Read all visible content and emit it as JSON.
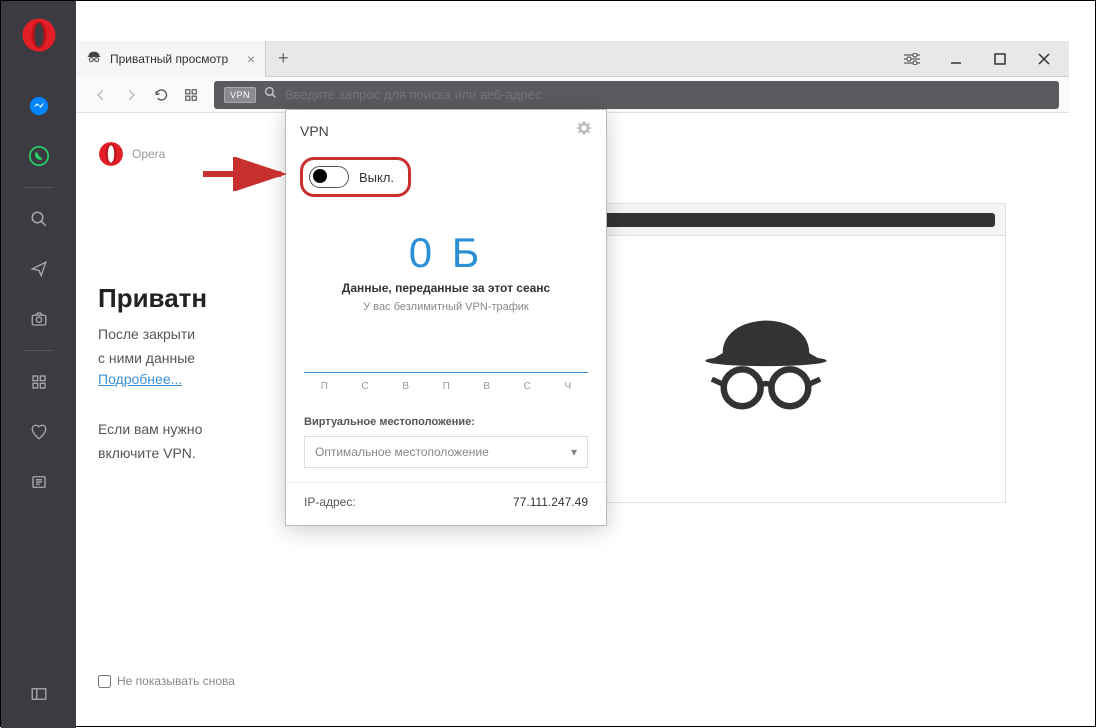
{
  "tab": {
    "title": "Приватный просмотр"
  },
  "address": {
    "placeholder": "Введите запрос для поиска или веб-адрес",
    "vpn_badge": "VPN"
  },
  "page": {
    "logo_text": "Opera",
    "heading": "Приватн",
    "line1": "После закрыти",
    "line2": "с ними данные",
    "learn_more": "Подробнее...",
    "line3": "Если вам нужно",
    "line4": "включите VPN.",
    "dont_show": "Не показывать снова"
  },
  "vpn": {
    "title": "VPN",
    "toggle_label": "Выкл.",
    "data_value": "0 Б",
    "data_label": "Данные, переданные за этот сеанс",
    "data_sub": "У вас безлимитный VPN-трафик",
    "days": [
      "П",
      "С",
      "В",
      "П",
      "В",
      "С",
      "Ч"
    ],
    "location_label": "Виртуальное местоположение:",
    "location_value": "Оптимальное местоположение",
    "ip_label": "IP-адрес:",
    "ip_value": "77.111.247.49"
  }
}
